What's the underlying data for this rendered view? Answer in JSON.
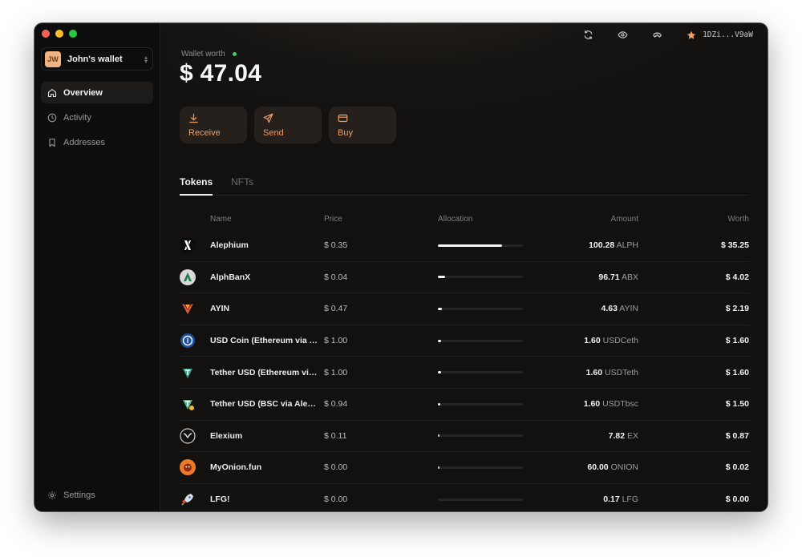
{
  "sidebar": {
    "wallet": {
      "initials": "JW",
      "name": "John's wallet"
    },
    "nav": [
      {
        "label": "Overview",
        "active": true,
        "icon": "home-icon"
      },
      {
        "label": "Activity",
        "active": false,
        "icon": "clock-icon"
      },
      {
        "label": "Addresses",
        "active": false,
        "icon": "bookmark-icon"
      }
    ],
    "settings_label": "Settings"
  },
  "topbar": {
    "icons": [
      "refresh-icon",
      "eye-icon",
      "walletconnect-icon"
    ],
    "address": "1DZi...V9aW",
    "address_icon": "star-icon"
  },
  "overview": {
    "worth_label": "Wallet worth",
    "worth_value": "$ 47.04",
    "status_color": "#3ecf72",
    "actions": [
      {
        "label": "Receive",
        "icon": "download-icon"
      },
      {
        "label": "Send",
        "icon": "send-icon"
      },
      {
        "label": "Buy",
        "icon": "card-icon"
      }
    ],
    "accent_color": "#ec9e66"
  },
  "tabs": [
    {
      "label": "Tokens",
      "active": true
    },
    {
      "label": "NFTs",
      "active": false
    }
  ],
  "table": {
    "headers": {
      "name": "Name",
      "price": "Price",
      "allocation": "Allocation",
      "amount": "Amount",
      "worth": "Worth"
    },
    "rows": [
      {
        "icon": "alephium-icon",
        "name": "Alephium",
        "price": "$ 0.35",
        "allocation": 0.75,
        "amount": "100.28",
        "symbol": "ALPH",
        "worth": "$ 35.25"
      },
      {
        "icon": "alphbanx-icon",
        "name": "AlphBanX",
        "price": "$ 0.04",
        "allocation": 0.085,
        "amount": "96.71",
        "symbol": "ABX",
        "worth": "$ 4.02"
      },
      {
        "icon": "ayin-icon",
        "name": "AYIN",
        "price": "$ 0.47",
        "allocation": 0.047,
        "amount": "4.63",
        "symbol": "AYIN",
        "worth": "$ 2.19"
      },
      {
        "icon": "usdc-icon",
        "name": "USD Coin (Ethereum via Alephium Bridge)",
        "price": "$ 1.00",
        "allocation": 0.034,
        "amount": "1.60",
        "symbol": "USDCeth",
        "worth": "$ 1.60"
      },
      {
        "icon": "tether-icon",
        "name": "Tether USD (Ethereum via Alephium Bridge)",
        "price": "$ 1.00",
        "allocation": 0.034,
        "amount": "1.60",
        "symbol": "USDTeth",
        "worth": "$ 1.60"
      },
      {
        "icon": "tether-bsc-icon",
        "name": "Tether USD (BSC via Alephium Bridge)",
        "price": "$ 0.94",
        "allocation": 0.032,
        "amount": "1.60",
        "symbol": "USDTbsc",
        "worth": "$ 1.50"
      },
      {
        "icon": "elexium-icon",
        "name": "Elexium",
        "price": "$ 0.11",
        "allocation": 0.018,
        "amount": "7.82",
        "symbol": "EX",
        "worth": "$ 0.87"
      },
      {
        "icon": "myonion-icon",
        "name": "MyOnion.fun",
        "price": "$ 0.00",
        "allocation": 0.004,
        "amount": "60.00",
        "symbol": "ONION",
        "worth": "$ 0.02"
      },
      {
        "icon": "lfg-icon",
        "name": "LFG!",
        "price": "$ 0.00",
        "allocation": 0.0,
        "amount": "0.17",
        "symbol": "LFG",
        "worth": "$ 0.00"
      }
    ]
  }
}
